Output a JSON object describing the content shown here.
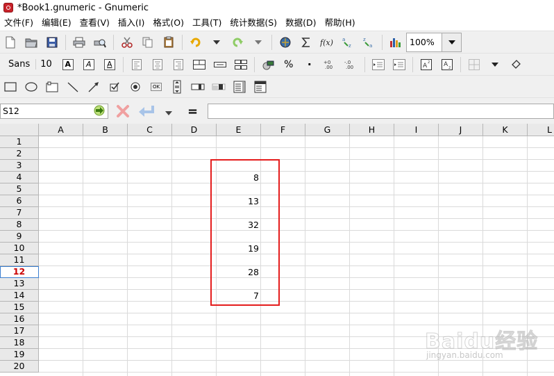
{
  "window": {
    "title": "*Book1.gnumeric - Gnumeric"
  },
  "menu": [
    "文件(F)",
    "编辑(E)",
    "查看(V)",
    "插入(I)",
    "格式(O)",
    "工具(T)",
    "统计数据(S)",
    "数据(D)",
    "帮助(H)"
  ],
  "toolbar": {
    "zoom_value": "100%"
  },
  "format_toolbar": {
    "font_name": "Sans",
    "font_size": "10",
    "bold_glyph": "A",
    "italic_glyph": "A",
    "underline_glyph": "A",
    "percent_glyph": "%",
    "comma_glyph": "·"
  },
  "object_toolbar": {
    "ok_label": "OK"
  },
  "formula_bar": {
    "cell_ref": "S12",
    "equals": "="
  },
  "sheet": {
    "columns": [
      "A",
      "B",
      "C",
      "D",
      "E",
      "F",
      "G",
      "H",
      "I",
      "J",
      "K",
      "L"
    ],
    "rows": [
      "1",
      "2",
      "3",
      "4",
      "5",
      "6",
      "7",
      "8",
      "9",
      "10",
      "11",
      "12",
      "13",
      "14",
      "15",
      "16",
      "17",
      "18",
      "19",
      "20"
    ],
    "active_row": "12",
    "cells": [
      {
        "ref": "E4",
        "value": "8"
      },
      {
        "ref": "E6",
        "value": "13"
      },
      {
        "ref": "E8",
        "value": "32"
      },
      {
        "ref": "E10",
        "value": "19"
      },
      {
        "ref": "E12",
        "value": "28"
      },
      {
        "ref": "E14",
        "value": "7"
      }
    ]
  },
  "watermark": {
    "text": "Baidu经验",
    "sub": "jingyan.baidu.com"
  },
  "colors": {
    "highlight_border": "#e41c1c",
    "active_row_text": "#cc0000",
    "grid": "#dadada"
  }
}
